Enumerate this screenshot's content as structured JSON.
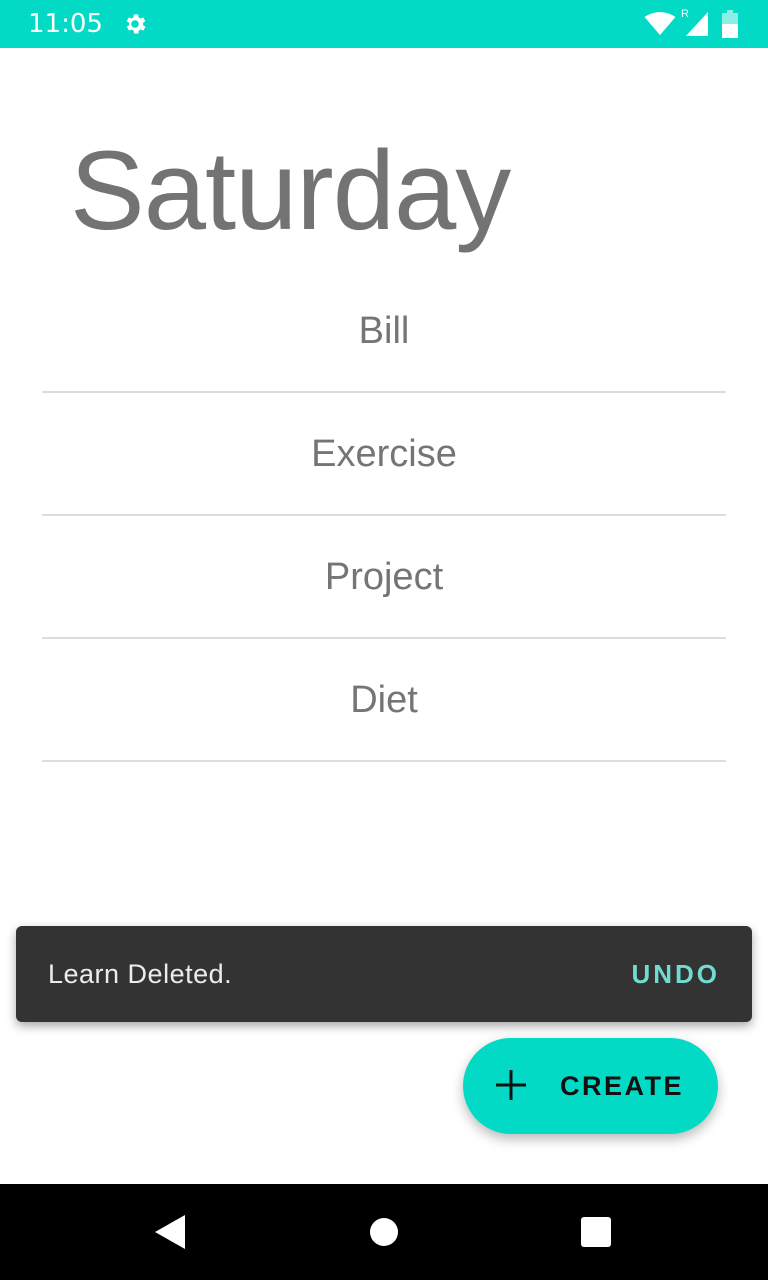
{
  "status_bar": {
    "time": "11:05",
    "roaming_indicator": "R",
    "background_color": "#03dac5",
    "icons": [
      "gear-icon",
      "wifi-icon",
      "cell-signal-icon",
      "battery-icon"
    ]
  },
  "page": {
    "title": "Saturday"
  },
  "categories": [
    {
      "label": "Bill"
    },
    {
      "label": "Exercise"
    },
    {
      "label": "Project"
    },
    {
      "label": "Diet"
    }
  ],
  "snackbar": {
    "message": "Learn Deleted.",
    "action_label": "UNDO",
    "action_color": "#6fdccf"
  },
  "fab": {
    "label": "CREATE",
    "icon": "plus-icon",
    "color": "#03dac5"
  },
  "nav_bar": {
    "icons": [
      "back-icon",
      "home-icon",
      "recents-icon"
    ]
  }
}
